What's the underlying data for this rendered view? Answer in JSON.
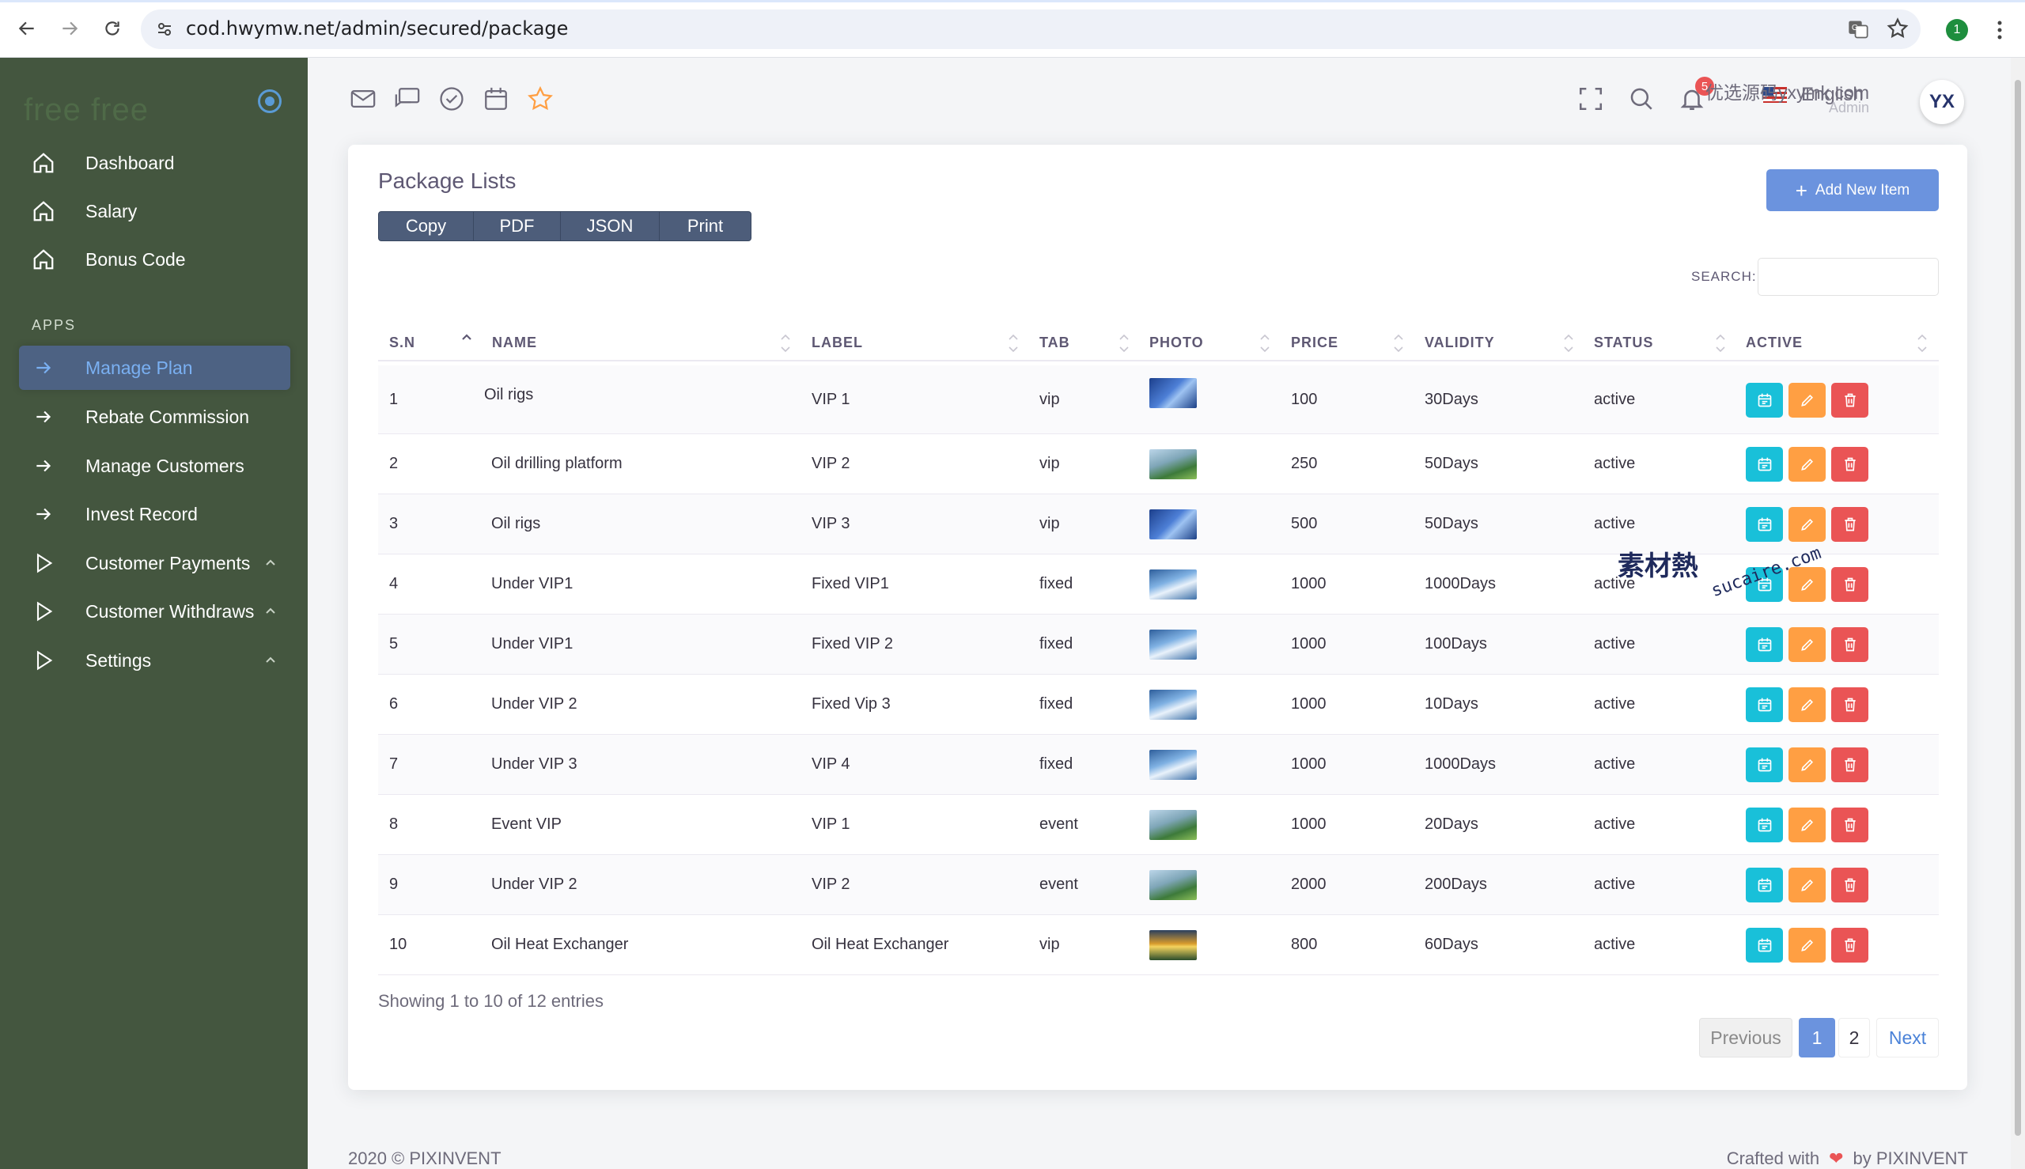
{
  "browser": {
    "url": "cod.hwymw.net/admin/secured/package",
    "profile_initial": "1"
  },
  "sidebar": {
    "brand": "free free",
    "section_label": "APPS",
    "items": [
      {
        "label": "Dashboard",
        "icon": "home-icon"
      },
      {
        "label": "Salary",
        "icon": "home-icon"
      },
      {
        "label": "Bonus Code",
        "icon": "home-icon"
      },
      {
        "label": "Manage Plan",
        "icon": "arrow-right-icon",
        "active": true
      },
      {
        "label": "Rebate Commission",
        "icon": "arrow-right-icon"
      },
      {
        "label": "Manage Customers",
        "icon": "arrow-right-icon"
      },
      {
        "label": "Invest Record",
        "icon": "arrow-right-icon"
      },
      {
        "label": "Customer Payments",
        "icon": "play-icon"
      },
      {
        "label": "Customer Withdraws",
        "icon": "play-icon"
      },
      {
        "label": "Settings",
        "icon": "play-icon"
      }
    ]
  },
  "header": {
    "language": "English",
    "notification_count": "5",
    "user_name": "优选源码yxymk.com",
    "user_role": "Admin",
    "avatar_text": "YX"
  },
  "card": {
    "title": "Package Lists",
    "export_buttons": [
      "Copy",
      "PDF",
      "JSON",
      "Print"
    ],
    "add_button": "Add New Item",
    "search_label": "SEARCH:",
    "search_value": ""
  },
  "table": {
    "columns": [
      "S.N",
      "NAME",
      "LABEL",
      "TAB",
      "PHOTO",
      "PRICE",
      "VALIDITY",
      "STATUS",
      "ACTIVE"
    ],
    "rows": [
      {
        "sn": "1",
        "name": "Oil rigs",
        "label": "VIP 1",
        "tab": "vip",
        "photo": "solar",
        "price": "100",
        "validity": "30Days",
        "status": "active"
      },
      {
        "sn": "2",
        "name": "Oil drilling platform",
        "label": "VIP 2",
        "tab": "vip",
        "photo": "green",
        "price": "250",
        "validity": "50Days",
        "status": "active"
      },
      {
        "sn": "3",
        "name": "Oil rigs",
        "label": "VIP 3",
        "tab": "vip",
        "photo": "solar",
        "price": "500",
        "validity": "50Days",
        "status": "active"
      },
      {
        "sn": "4",
        "name": "Under VIP1",
        "label": "Fixed VIP1",
        "tab": "fixed",
        "photo": "turbine",
        "price": "1000",
        "validity": "1000Days",
        "status": "active"
      },
      {
        "sn": "5",
        "name": "Under VIP1",
        "label": "Fixed VIP 2",
        "tab": "fixed",
        "photo": "turbine",
        "price": "1000",
        "validity": "100Days",
        "status": "active"
      },
      {
        "sn": "6",
        "name": "Under VIP 2",
        "label": "Fixed Vip 3",
        "tab": "fixed",
        "photo": "turbine",
        "price": "1000",
        "validity": "10Days",
        "status": "active"
      },
      {
        "sn": "7",
        "name": "Under VIP 3",
        "label": "VIP 4",
        "tab": "fixed",
        "photo": "turbine",
        "price": "1000",
        "validity": "1000Days",
        "status": "active"
      },
      {
        "sn": "8",
        "name": "Event VIP",
        "label": "VIP 1",
        "tab": "event",
        "photo": "green",
        "price": "1000",
        "validity": "20Days",
        "status": "active"
      },
      {
        "sn": "9",
        "name": "Under VIP 2",
        "label": "VIP 2",
        "tab": "event",
        "photo": "green",
        "price": "2000",
        "validity": "200Days",
        "status": "active"
      },
      {
        "sn": "10",
        "name": "Oil Heat Exchanger",
        "label": "Oil Heat Exchanger",
        "tab": "vip",
        "photo": "sunset",
        "price": "800",
        "validity": "60Days",
        "status": "active"
      }
    ]
  },
  "pagination": {
    "summary": "Showing 1 to 10 of 12 entries",
    "prev": "Previous",
    "pages": [
      "1",
      "2"
    ],
    "next": "Next",
    "current": "1"
  },
  "watermark": {
    "main": "素材熱",
    "sub": "sucaire.com"
  },
  "footer": {
    "left": "2020 © PIXINVENT",
    "right_prefix": "Crafted with",
    "right_suffix": "by PIXINVENT"
  },
  "colors": {
    "sidebar_bg": "#44563f",
    "active_item_bg": "#4d6283",
    "primary": "#6b93de",
    "view_btn": "#19c0d9",
    "edit_btn": "#ff9f43",
    "delete_btn": "#ea5455"
  }
}
